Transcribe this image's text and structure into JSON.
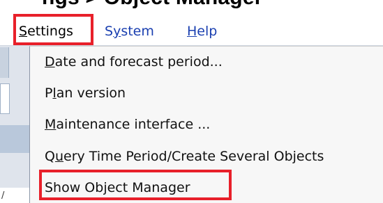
{
  "heading_fragment": "ngs > Object Manager",
  "menubar": {
    "settings": {
      "mnemonic": "S",
      "rest": "ettings"
    },
    "system": {
      "before": "S",
      "mnemonic": "y",
      "rest": "stem"
    },
    "help": {
      "mnemonic": "H",
      "rest": "elp"
    }
  },
  "settings_menu": {
    "items": [
      {
        "mnemonic": "D",
        "rest": "ate and forecast period..."
      },
      {
        "before": "P",
        "mnemonic": "l",
        "rest": "an version"
      },
      {
        "mnemonic": "M",
        "rest": "aintenance interface ..."
      },
      {
        "before": "Q",
        "mnemonic": "u",
        "rest": "ery Time Period/Create Several Objects"
      },
      {
        "before": "Show Object Manager",
        "mnemonic": "",
        "rest": ""
      }
    ]
  },
  "background_fragment": "/",
  "colors": {
    "highlight_border": "#e8202a",
    "menu_link": "#1a3fb0",
    "menu_bg": "#f7f7f7"
  }
}
